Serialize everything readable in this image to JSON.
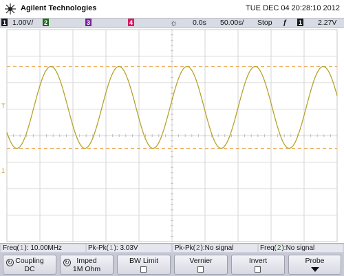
{
  "header": {
    "brand": "Agilent Technologies",
    "datetime": "TUE DEC 04 20:28:10 2012"
  },
  "status_bar": {
    "ch1_label": "1",
    "ch1_scale": "1.00V/",
    "ch2_label": "2",
    "ch3_label": "3",
    "ch4_label": "4",
    "delay": "0.0s",
    "timebase": "50.00s/",
    "run_state": "Stop",
    "trigger_source": "1",
    "trigger_level": "2.27V"
  },
  "waveform": {
    "channel": "1",
    "color": "#b5a32a",
    "cursor_color": "#e8a24a",
    "cycles_on_screen": 5,
    "upper_cursor_level": 0.174,
    "lower_cursor_level": 0.56
  },
  "measurements": [
    {
      "pre": "Freq(",
      "num": "1",
      "post": "): 10.00MHz",
      "cls": "m1"
    },
    {
      "pre": "Pk-Pk(",
      "num": "1",
      "post": "): 3.03V",
      "cls": "m1"
    },
    {
      "pre": "Pk-Pk(",
      "num": "2",
      "post": "):No signal",
      "cls": "m2"
    },
    {
      "pre": "Freq(",
      "num": "2",
      "post": "):No signal",
      "cls": "m2"
    }
  ],
  "softkeys": {
    "coupling_title": "Coupling",
    "coupling_value": "DC",
    "imped_title": "Imped",
    "imped_value": "1M Ohm",
    "bwlimit_title": "BW Limit",
    "vernier_title": "Vernier",
    "invert_title": "Invert",
    "probe_title": "Probe"
  }
}
